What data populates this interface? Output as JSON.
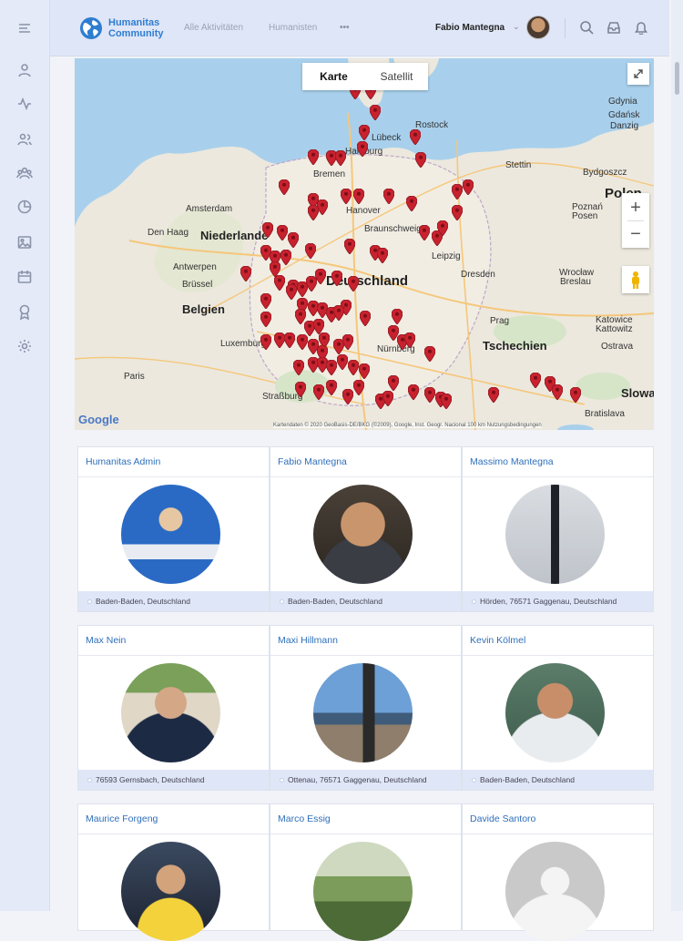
{
  "brand": {
    "line1": "Humanitas",
    "line2": "Community"
  },
  "nav": {
    "activities": "Alle Aktivitäten",
    "members": "Humanisten",
    "more": "•••"
  },
  "user": {
    "name": "Fabio Mantegna"
  },
  "map": {
    "tabs": [
      "Karte",
      "Satellit"
    ],
    "active_tab": "Karte",
    "zoom_in": "+",
    "zoom_out": "−",
    "google": "Google",
    "attribution": "Kartendaten © 2020 GeoBasis-DE/BKG (©2009), Google, Inst. Geogr. Nacional     100 km        Nutzungsbedingungen",
    "labels": {
      "gdynia": "Gdynia",
      "gdansk": "Gdańsk",
      "danzig": "Danzig",
      "rostock": "Rostock",
      "lubeck": "Lübeck",
      "hamburg": "Hamburg",
      "bremen": "Bremen",
      "stettin": "Stettin",
      "bydgoszcz": "Bydgoszcz",
      "amsterdam": "Amsterdam",
      "denhaag": "Den Haag",
      "niederlande": "Niederlande",
      "hannover": "Hanover",
      "braunschweig": "Braunschweig",
      "poznan": "Poznań",
      "posen": "Posen",
      "polen": "Polen",
      "antwerpen": "Antwerpen",
      "brussel": "Brüssel",
      "belgien": "Belgien",
      "deutschland": "Deutschland",
      "leipzig": "Leipzig",
      "dresden": "Dresden",
      "wroclaw": "Wrocław",
      "breslau": "Breslau",
      "prag": "Prag",
      "katowice": "Katowice",
      "kattowitz": "Kattowitz",
      "tschechien": "Tschechien",
      "luxemburg": "Luxemburg",
      "ostrava": "Ostrava",
      "paris": "Paris",
      "strasbourg": "Straßburg",
      "nurnberg": "Nürnberg",
      "bratislava": "Bratislava",
      "slowakei": "Slowa"
    }
  },
  "members": [
    {
      "name": "Humanitas Admin",
      "location": "Baden-Baden, Deutschland"
    },
    {
      "name": "Fabio Mantegna",
      "location": "Baden-Baden, Deutschland"
    },
    {
      "name": "Massimo Mantegna",
      "location": "Hörden, 76571 Gaggenau, Deutschland"
    },
    {
      "name": "Max Nein",
      "location": "76593 Gernsbach, Deutschland"
    },
    {
      "name": "Maxi Hillmann",
      "location": "Ottenau, 76571 Gaggenau, Deutschland"
    },
    {
      "name": "Kevin Kölmel",
      "location": "Baden-Baden, Deutschland"
    },
    {
      "name": "Maurice Forgeng",
      "location": ""
    },
    {
      "name": "Marco Essig",
      "location": ""
    },
    {
      "name": "Davide Santoro",
      "location": ""
    }
  ]
}
